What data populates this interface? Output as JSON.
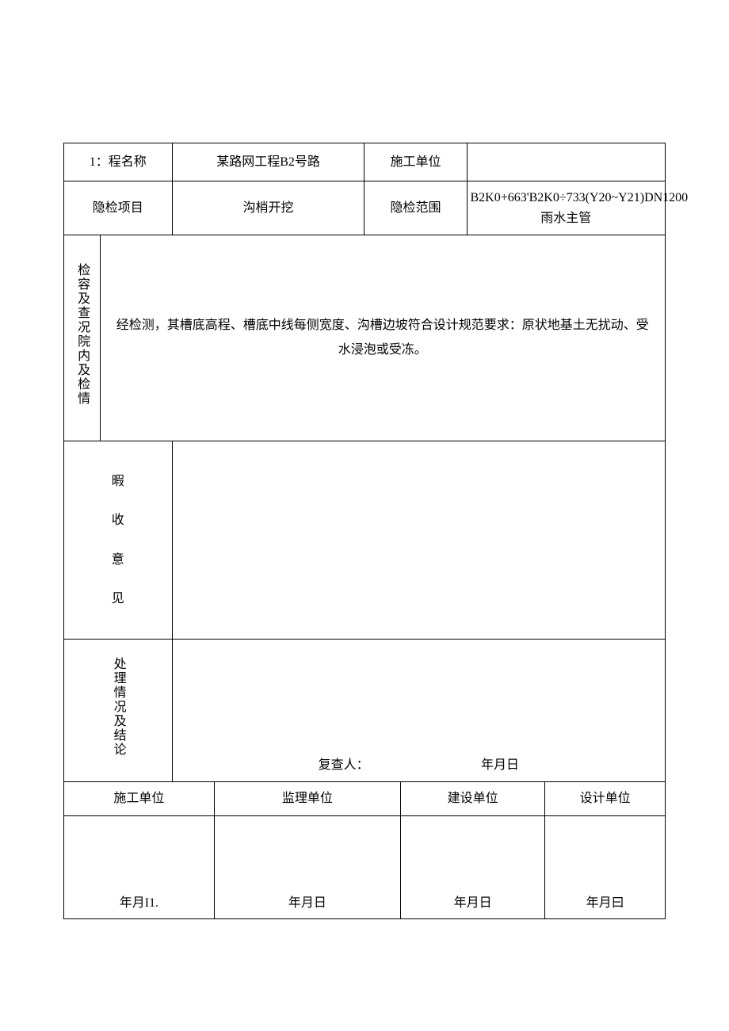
{
  "header": {
    "project_name_label": "1：程名称",
    "project_name_value": "某路网工程B2号路",
    "construction_unit_label": "施工单位",
    "construction_unit_value": "",
    "inspection_item_label": "隐检项目",
    "inspection_item_value": "沟梢开挖",
    "inspection_scope_label": "隐检范围",
    "inspection_scope_value": "B2K0+663'B2K0÷733(Y20~Y21)DN1200雨水主管"
  },
  "inspection": {
    "side_label": "检容及查况院内及检情",
    "body": "经检测，其槽底高程、槽底中线每侧宽度、沟槽边坡符合设计规范要求：原状地基土无扰动、受水浸泡或受冻。"
  },
  "acceptance": {
    "char1": "暇",
    "char2": "收",
    "char3": "意",
    "char4": "见"
  },
  "conclusion": {
    "side_label": "处理情况及结论",
    "reviewer_label": "复查人：",
    "date_label": "年月日"
  },
  "signatures": {
    "construction": "施工单位",
    "supervision": "监理单位",
    "owner": "建设单位",
    "design": "设计单位",
    "date1": "年月I1.",
    "date2": "年月日",
    "date3": "年月日",
    "date4": "年月曰"
  }
}
